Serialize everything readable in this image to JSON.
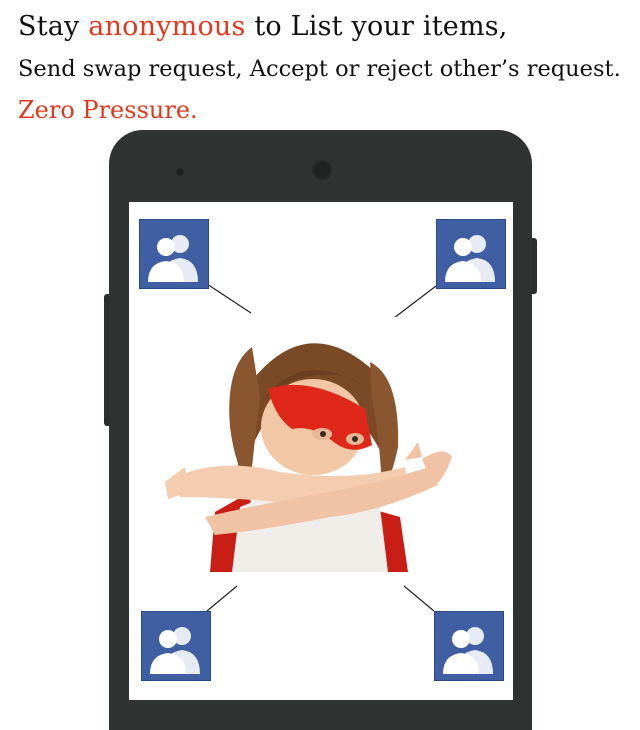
{
  "headline": {
    "line1_prefix": "Stay ",
    "line1_accent": "anonymous",
    "line1_suffix": " to List your items,",
    "line2": "Send swap request, Accept or reject other’s request.",
    "line3": "Zero Pressure."
  },
  "colors": {
    "accent": "#e0391f",
    "text": "#111111",
    "phone_body": "#2f3432",
    "icon_blue": "#3f5fa2"
  },
  "icons": {
    "user_group": "two-people-silhouette-icon",
    "center": "masked-child-photo"
  }
}
